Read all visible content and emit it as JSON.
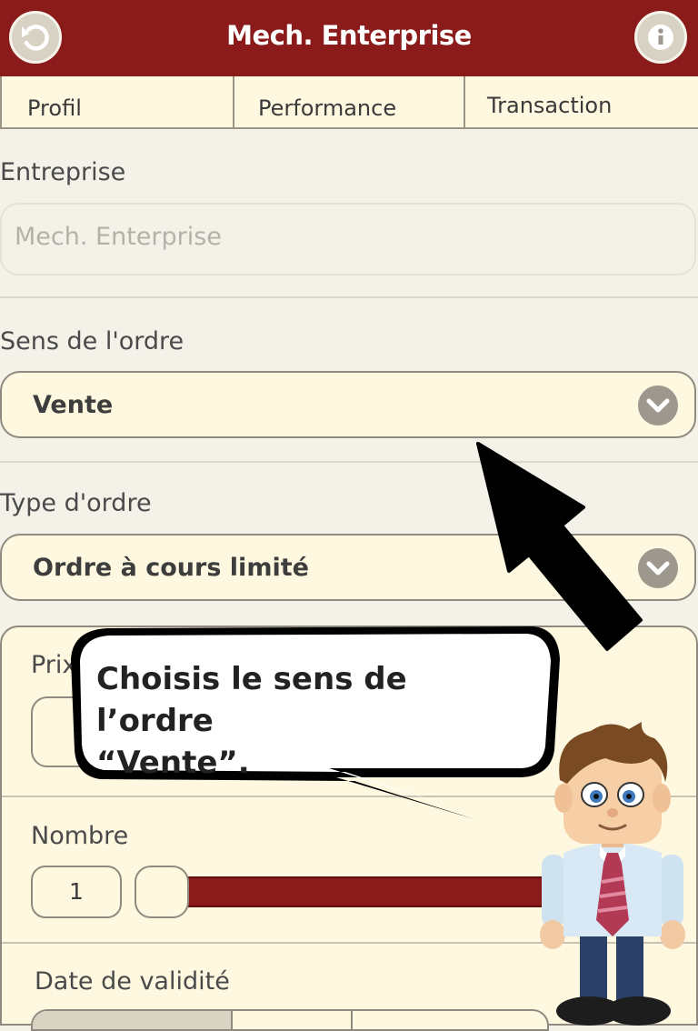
{
  "header": {
    "title": "Mech. Enterprise",
    "back_icon": "back-arrow-icon",
    "info_icon": "info-icon",
    "color": "#8b1a1a"
  },
  "tabs": [
    {
      "label": "Profil"
    },
    {
      "label": "Performance"
    },
    {
      "label": "Transaction"
    }
  ],
  "form": {
    "entreprise": {
      "label": "Entreprise",
      "placeholder": "Mech. Enterprise"
    },
    "sens": {
      "label": "Sens de l'ordre",
      "value": "Vente"
    },
    "type": {
      "label": "Type d'ordre",
      "value": "Ordre à cours limité"
    },
    "prix": {
      "label": "Prix"
    },
    "nombre": {
      "label": "Nombre",
      "value": "1"
    },
    "date": {
      "label": "Date de validité"
    }
  },
  "tutorial": {
    "bubble_line1": "Choisis le sens de l’ordre",
    "bubble_line2": "“Vente”."
  }
}
